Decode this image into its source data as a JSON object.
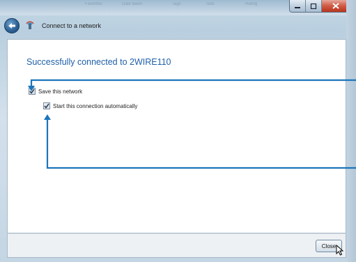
{
  "window": {
    "title": "Connect to a network",
    "ghost_tabs": [
      "Favorites",
      "Date taken",
      "Tags",
      "Size",
      "Rating"
    ],
    "controls": {
      "minimize_icon": "minimize-icon",
      "maximize_icon": "maximize-icon",
      "close_icon": "close-icon"
    }
  },
  "nav": {
    "back_icon": "back-arrow-icon",
    "network_icon": "network-icon"
  },
  "main": {
    "heading": "Successfully connected to 2WIRE110",
    "save_network": {
      "label": "Save this network",
      "checked": true
    },
    "auto_start": {
      "label": "Start this connection automatically",
      "checked": true
    }
  },
  "footer": {
    "close_label": "Close"
  },
  "colors": {
    "heading": "#1f5fa9",
    "callout_arrow": "#1b75bc",
    "close_button_red": "#cf5a44"
  }
}
